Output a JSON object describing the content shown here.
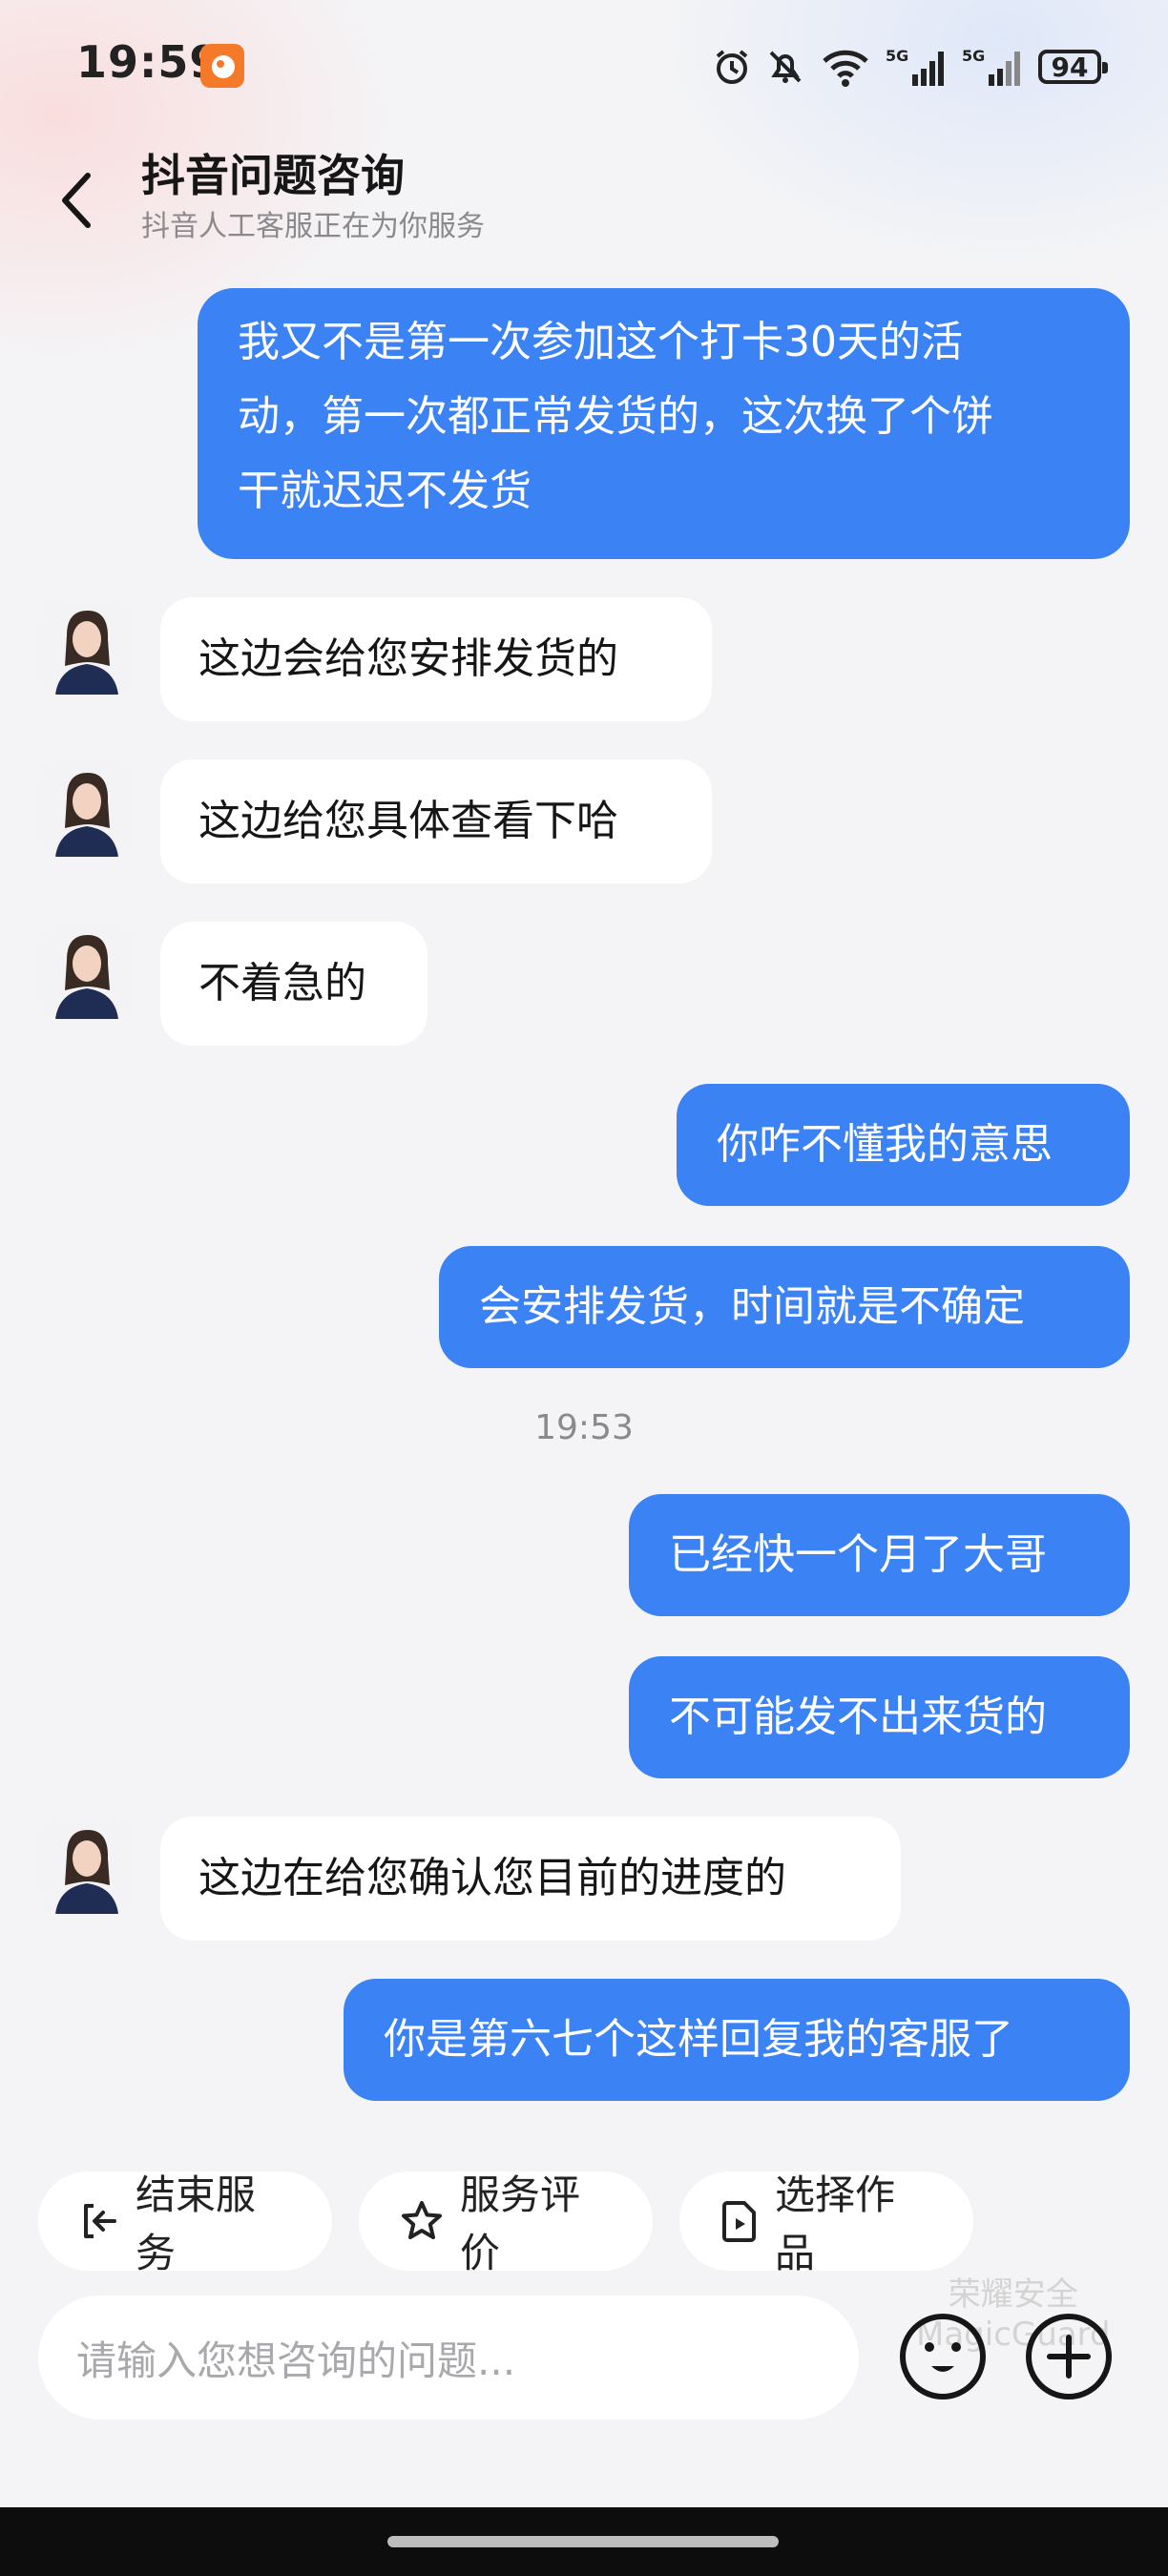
{
  "status_bar": {
    "time": "19:59",
    "battery": "94",
    "icons": [
      "app-notification-icon",
      "alarm-icon",
      "mute-icon",
      "wifi-icon",
      "signal-5g-icon",
      "signal-5g-icon",
      "battery-icon"
    ]
  },
  "header": {
    "title": "抖音问题咨询",
    "subtitle": "抖音人工客服正在为你服务",
    "back_icon": "chevron-left-icon"
  },
  "messages": [
    {
      "side": "out",
      "lines": [
        "我又不是第一次参加这个打卡30天的活",
        "动，第一次都正常发货的，这次换了个饼",
        "干就迟迟不发货"
      ]
    },
    {
      "side": "in",
      "text": "这边会给您安排发货的"
    },
    {
      "side": "in",
      "text": "这边给您具体查看下哈"
    },
    {
      "side": "in",
      "text": "不着急的"
    },
    {
      "side": "out",
      "text": "你咋不懂我的意思"
    },
    {
      "side": "out",
      "text": "会安排发货，时间就是不确定"
    },
    {
      "side": "time",
      "text": "19:53"
    },
    {
      "side": "out",
      "text": "已经快一个月了大哥"
    },
    {
      "side": "out",
      "text": "不可能发不出来货的"
    },
    {
      "side": "in",
      "text": "这边在给您确认您目前的进度的"
    },
    {
      "side": "out",
      "text": "你是第六七个这样回复我的客服了"
    }
  ],
  "quick_actions": [
    {
      "label": "结束服务",
      "icon": "exit-icon"
    },
    {
      "label": "服务评价",
      "icon": "star-icon"
    },
    {
      "label": "选择作品",
      "icon": "video-file-icon"
    }
  ],
  "input": {
    "placeholder": "请输入您想咨询的问题..."
  },
  "watermark": {
    "line1": "荣耀安全",
    "line2": "MagicGuard"
  },
  "colors": {
    "outgoing_bubble": "#3b83f5",
    "incoming_bubble": "#ffffff",
    "background": "#f4f4f6"
  }
}
